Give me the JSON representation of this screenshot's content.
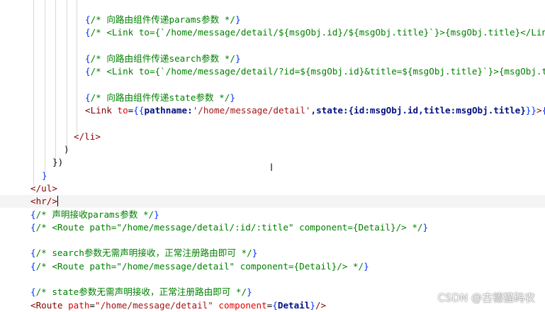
{
  "editor": {
    "lines": [
      {
        "indent": 120,
        "segments": [
          {
            "c": "brace",
            "t": "{"
          },
          {
            "c": "cmt",
            "t": "/* 向路由组件传递params参数 */"
          },
          {
            "c": "brace",
            "t": "}"
          }
        ]
      },
      {
        "indent": 120,
        "segments": [
          {
            "c": "brace",
            "t": "{"
          },
          {
            "c": "cmt",
            "t": "/* <Link to={`/home/message/detail/${msgObj.id}/${msgObj.title}`}>{msgObj.title}</Link> */"
          },
          {
            "c": "brace",
            "t": "}"
          }
        ]
      },
      {
        "indent": 120,
        "segments": []
      },
      {
        "indent": 120,
        "segments": [
          {
            "c": "brace",
            "t": "{"
          },
          {
            "c": "cmt",
            "t": "/* 向路由组件传递search参数 */"
          },
          {
            "c": "brace",
            "t": "}"
          }
        ]
      },
      {
        "indent": 120,
        "segments": [
          {
            "c": "brace",
            "t": "{"
          },
          {
            "c": "cmt",
            "t": "/* <Link to={`/home/message/detail/?id=${msgObj.id}&title=${msgObj.title}`}>{msgObj.title}</Link> */"
          },
          {
            "c": "brace",
            "t": "}"
          }
        ]
      },
      {
        "indent": 120,
        "segments": []
      },
      {
        "indent": 120,
        "segments": [
          {
            "c": "brace",
            "t": "{"
          },
          {
            "c": "cmt",
            "t": "/* 向路由组件传递state参数 */"
          },
          {
            "c": "brace",
            "t": "}"
          }
        ]
      },
      {
        "indent": 120,
        "segments": [
          {
            "c": "tag",
            "t": "<Link "
          },
          {
            "c": "attr",
            "t": "to"
          },
          {
            "c": "plain",
            "t": "="
          },
          {
            "c": "brace",
            "t": "{{"
          },
          {
            "c": "expr",
            "t": "pathname:"
          },
          {
            "c": "str",
            "t": "'/home/message/detail'"
          },
          {
            "c": "expr",
            "t": ",state:{id:msgObj.id,title:msgObj.title}"
          },
          {
            "c": "brace",
            "t": "}}"
          },
          {
            "c": "tag",
            "t": ">"
          },
          {
            "c": "brace",
            "t": "{"
          }
        ]
      },
      {
        "indent": 120,
        "segments": []
      },
      {
        "indent": 104,
        "segments": [
          {
            "c": "tag",
            "t": "</li>"
          }
        ]
      },
      {
        "indent": 90,
        "segments": [
          {
            "c": "plain",
            "t": ")"
          }
        ]
      },
      {
        "indent": 74,
        "segments": [
          {
            "c": "plain",
            "t": "})"
          }
        ]
      },
      {
        "indent": 59,
        "segments": [
          {
            "c": "brace",
            "t": "}"
          }
        ]
      },
      {
        "indent": 43,
        "segments": [
          {
            "c": "tag",
            "t": "</ul>"
          }
        ]
      },
      {
        "indent": 43,
        "cursor": true,
        "segments": [
          {
            "c": "tag",
            "t": "<hr/>"
          }
        ]
      },
      {
        "indent": 43,
        "segments": [
          {
            "c": "brace",
            "t": "{"
          },
          {
            "c": "cmt",
            "t": "/* 声明接收params参数 */"
          },
          {
            "c": "brace",
            "t": "}"
          }
        ]
      },
      {
        "indent": 43,
        "segments": [
          {
            "c": "brace",
            "t": "{"
          },
          {
            "c": "cmt",
            "t": "/* <Route path=\"/home/message/detail/:id/:title\" component={Detail}/> */"
          },
          {
            "c": "brace",
            "t": "}"
          }
        ]
      },
      {
        "indent": 43,
        "segments": []
      },
      {
        "indent": 43,
        "segments": [
          {
            "c": "brace",
            "t": "{"
          },
          {
            "c": "cmt",
            "t": "/* search参数无需声明接收，正常注册路由即可 */"
          },
          {
            "c": "brace",
            "t": "}"
          }
        ]
      },
      {
        "indent": 43,
        "segments": [
          {
            "c": "brace",
            "t": "{"
          },
          {
            "c": "cmt",
            "t": "/* <Route path=\"/home/message/detail\" component={Detail}/> */"
          },
          {
            "c": "brace",
            "t": "}"
          }
        ]
      },
      {
        "indent": 43,
        "segments": []
      },
      {
        "indent": 43,
        "segments": [
          {
            "c": "brace",
            "t": "{"
          },
          {
            "c": "cmt",
            "t": "/* state参数无需声明接收，正常注册路由即可 */"
          },
          {
            "c": "brace",
            "t": "}"
          }
        ]
      },
      {
        "indent": 43,
        "segments": [
          {
            "c": "tag",
            "t": "<Route "
          },
          {
            "c": "attr",
            "t": "path"
          },
          {
            "c": "plain",
            "t": "="
          },
          {
            "c": "str",
            "t": "\"/home/message/detail\""
          },
          {
            "c": "plain",
            "t": " "
          },
          {
            "c": "attr",
            "t": "component"
          },
          {
            "c": "plain",
            "t": "="
          },
          {
            "c": "brace",
            "t": "{"
          },
          {
            "c": "expr",
            "t": "Detail"
          },
          {
            "c": "brace",
            "t": "}"
          },
          {
            "c": "tag",
            "t": "/>"
          }
        ]
      }
    ]
  },
  "watermark": {
    "text": "CSDN @古德猫码农"
  }
}
